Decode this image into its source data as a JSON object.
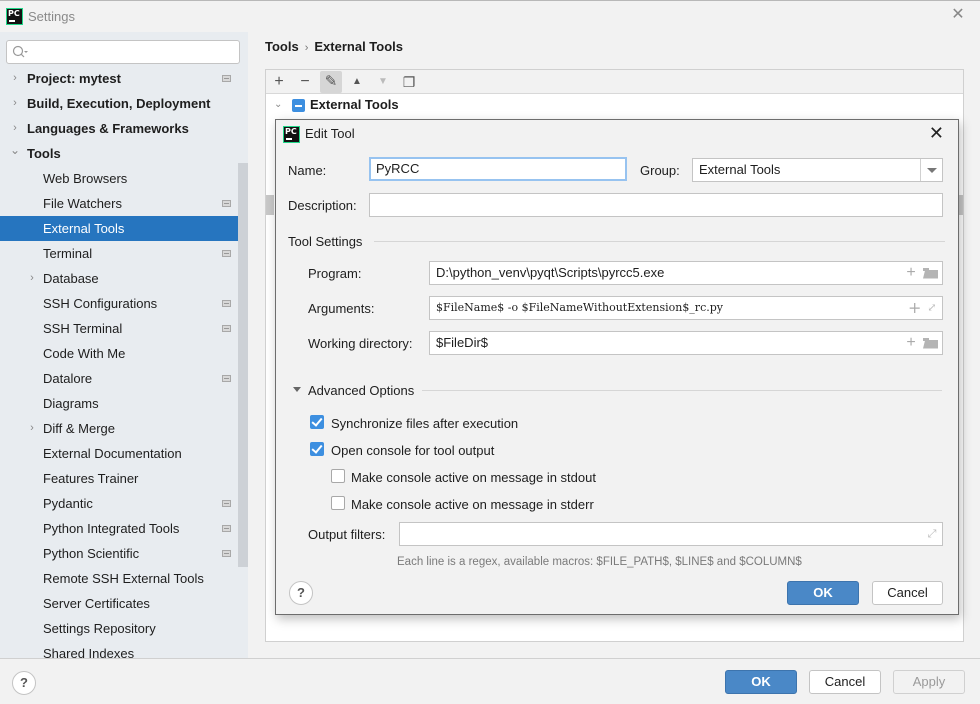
{
  "window": {
    "title": "Settings",
    "close_icon": "close-icon"
  },
  "sidebar": {
    "search": {
      "value": "",
      "placeholder": ""
    },
    "items": [
      {
        "label": "Project: mytest",
        "level": 0,
        "expandable": true,
        "expanded": false,
        "badge": true,
        "selected": false
      },
      {
        "label": "Build, Execution, Deployment",
        "level": 0,
        "expandable": true,
        "expanded": false,
        "badge": false,
        "selected": false
      },
      {
        "label": "Languages & Frameworks",
        "level": 0,
        "expandable": true,
        "expanded": false,
        "badge": false,
        "selected": false
      },
      {
        "label": "Tools",
        "level": 0,
        "expandable": true,
        "expanded": true,
        "badge": false,
        "selected": false
      },
      {
        "label": "Web Browsers",
        "level": 1,
        "expandable": false,
        "badge": false,
        "selected": false
      },
      {
        "label": "File Watchers",
        "level": 1,
        "expandable": false,
        "badge": true,
        "selected": false
      },
      {
        "label": "External Tools",
        "level": 1,
        "expandable": false,
        "badge": false,
        "selected": true
      },
      {
        "label": "Terminal",
        "level": 1,
        "expandable": false,
        "badge": true,
        "selected": false
      },
      {
        "label": "Database",
        "level": 1,
        "expandable": true,
        "expanded": false,
        "badge": false,
        "selected": false
      },
      {
        "label": "SSH Configurations",
        "level": 1,
        "expandable": false,
        "badge": true,
        "selected": false
      },
      {
        "label": "SSH Terminal",
        "level": 1,
        "expandable": false,
        "badge": true,
        "selected": false
      },
      {
        "label": "Code With Me",
        "level": 1,
        "expandable": false,
        "badge": false,
        "selected": false
      },
      {
        "label": "Datalore",
        "level": 1,
        "expandable": false,
        "badge": true,
        "selected": false
      },
      {
        "label": "Diagrams",
        "level": 1,
        "expandable": false,
        "badge": false,
        "selected": false
      },
      {
        "label": "Diff & Merge",
        "level": 1,
        "expandable": true,
        "expanded": false,
        "badge": false,
        "selected": false
      },
      {
        "label": "External Documentation",
        "level": 1,
        "expandable": false,
        "badge": false,
        "selected": false
      },
      {
        "label": "Features Trainer",
        "level": 1,
        "expandable": false,
        "badge": false,
        "selected": false
      },
      {
        "label": "Pydantic",
        "level": 1,
        "expandable": false,
        "badge": true,
        "selected": false
      },
      {
        "label": "Python Integrated Tools",
        "level": 1,
        "expandable": false,
        "badge": true,
        "selected": false
      },
      {
        "label": "Python Scientific",
        "level": 1,
        "expandable": false,
        "badge": true,
        "selected": false
      },
      {
        "label": "Remote SSH External Tools",
        "level": 1,
        "expandable": false,
        "badge": false,
        "selected": false
      },
      {
        "label": "Server Certificates",
        "level": 1,
        "expandable": false,
        "badge": false,
        "selected": false
      },
      {
        "label": "Settings Repository",
        "level": 1,
        "expandable": false,
        "badge": false,
        "selected": false
      },
      {
        "label": "Shared Indexes",
        "level": 1,
        "expandable": false,
        "badge": false,
        "selected": false
      }
    ]
  },
  "breadcrumb": {
    "parent": "Tools",
    "separator": "›",
    "current": "External Tools"
  },
  "toolbar": {
    "add": "+",
    "remove": "−",
    "edit": "✎",
    "move_up": "▲",
    "move_down": "▼",
    "copy": "❐"
  },
  "tree_group": {
    "label": "External Tools",
    "checked": "partial"
  },
  "dialog": {
    "title": "Edit Tool",
    "name_label": "Name:",
    "name_value": "PyRCC",
    "group_label": "Group:",
    "group_value": "External Tools",
    "description_label": "Description:",
    "description_value": "",
    "tool_settings_label": "Tool Settings",
    "program_label": "Program:",
    "program_value": "D:\\python_venv\\pyqt\\Scripts\\pyrcc5.exe",
    "arguments_label": "Arguments:",
    "arguments_value": "$FileName$ -o $FileNameWithoutExtension$_rc.py",
    "workdir_label": "Working directory:",
    "workdir_value": "$FileDir$",
    "advanced_label": "Advanced Options",
    "options": [
      {
        "label": "Synchronize files after execution",
        "checked": true
      },
      {
        "label": "Open console for tool output",
        "checked": true
      },
      {
        "label": "Make console active on message in stdout",
        "checked": false
      },
      {
        "label": "Make console active on message in stderr",
        "checked": false
      }
    ],
    "output_filters_label": "Output filters:",
    "output_filters_value": "",
    "hint": "Each line is a regex, available macros: $FILE_PATH$, $LINE$ and $COLUMN$",
    "help": "?",
    "ok": "OK",
    "cancel": "Cancel"
  },
  "footer": {
    "help": "?",
    "ok": "OK",
    "cancel": "Cancel",
    "apply": "Apply"
  },
  "colors": {
    "accent": "#2675bf",
    "primary_button": "#4a88c7",
    "checkbox": "#3d8fe0"
  }
}
